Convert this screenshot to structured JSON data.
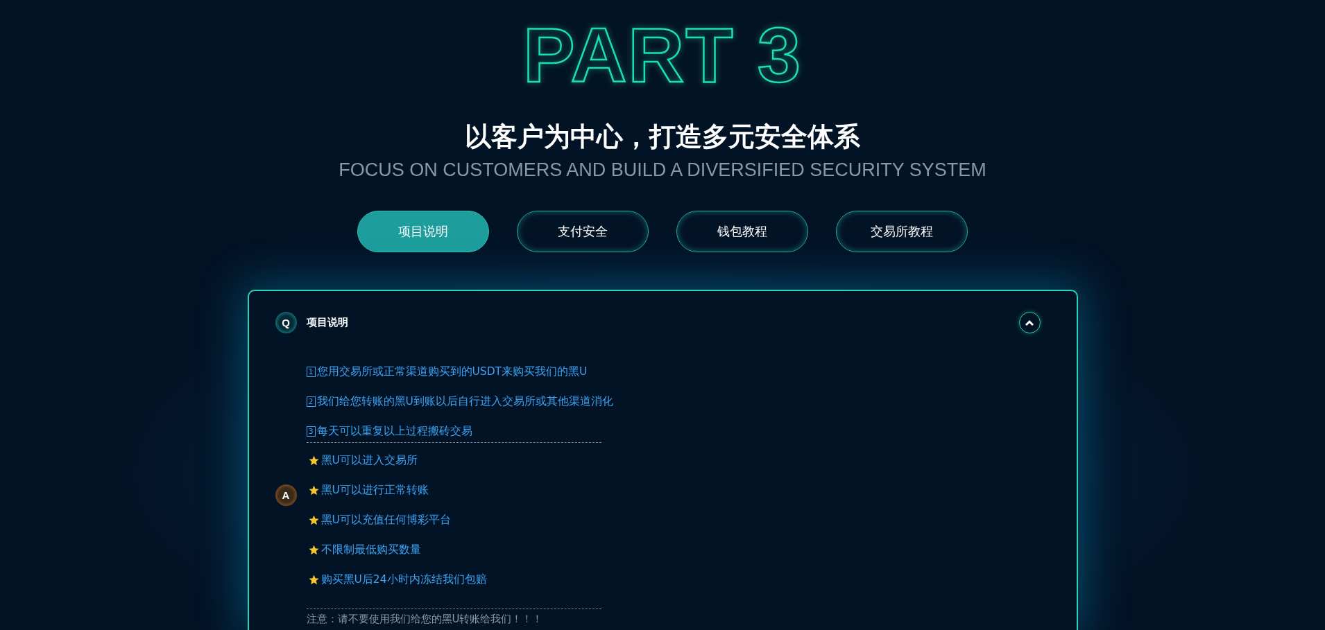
{
  "heading": {
    "part": "PART 3",
    "title": "以客户为中心，打造多元安全体系",
    "subtitle": "FOCUS ON CUSTOMERS AND BUILD A DIVERSIFIED SECURITY SYSTEM"
  },
  "tabs": [
    {
      "label": "项目说明",
      "selected": true
    },
    {
      "label": "支付安全",
      "selected": false
    },
    {
      "label": "钱包教程",
      "selected": false
    },
    {
      "label": "交易所教程",
      "selected": false
    }
  ],
  "faq": {
    "question_badge": "Q",
    "question": "项目说明",
    "expanded": true,
    "answer_badge": "A",
    "steps": [
      {
        "index": "1",
        "text": "您用交易所或正常渠道购买到的USDT来购买我们的黑U"
      },
      {
        "index": "2",
        "text": "我们给您转账的黑U到账以后自行进入交易所或其他渠道消化"
      },
      {
        "index": "3",
        "text": "每天可以重复以上过程搬砖交易"
      }
    ],
    "features": [
      "黑U可以进入交易所",
      "黑U可以进行正常转账",
      "黑U可以充值任何博彩平台",
      "不限制最低购买数量",
      "购买黑U后24小时内冻结我们包赔"
    ],
    "note": "注意：请不要使用我们给您的黑U转账给我们！！！"
  }
}
